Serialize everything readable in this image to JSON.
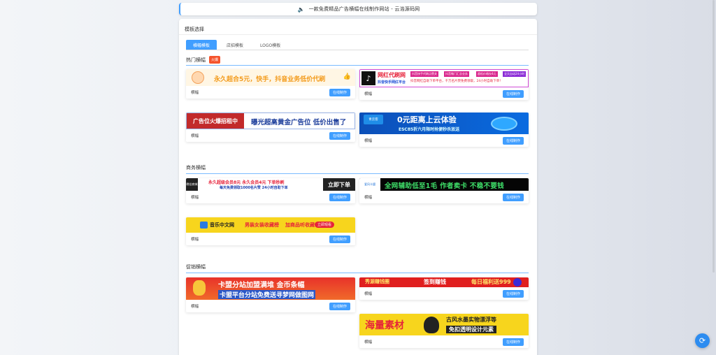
{
  "notice": {
    "text": "一款免费精品广告横幅在线制作网站 - 云浩源码网",
    "icon": "speaker-icon"
  },
  "panel": {
    "title": "模板选择"
  },
  "tabs": [
    {
      "label": "横幅模板",
      "active": true
    },
    {
      "label": "店招模板",
      "active": false
    },
    {
      "label": "LOGO模板",
      "active": false
    }
  ],
  "sections": {
    "hot": {
      "title": "热门横幅",
      "badge": "火爆"
    },
    "business": {
      "title": "商务横幅"
    },
    "promo": {
      "title": "促销横幅"
    }
  },
  "card_label": "横幅",
  "card_button": "在线制作",
  "banners": {
    "b1": {
      "text": "永久超合5元，快手，抖音业务低价代刷"
    },
    "b2": {
      "title": "网红代刷网",
      "sub": "抖音快手网红平台",
      "tags": [
        "抖音快手代刷点赞关",
        "抖音微门汇总业务",
        "超低价格仅4元",
        "全天自动24小时"
      ],
      "desc": "抖音网红自助下单平台，千万名片赞免费领取，24小时自助下单！"
    },
    "b3": {
      "tag": "广告位火爆招租中",
      "text": "曝光超高黄金广告位 低价出售了"
    },
    "b4": {
      "logo": "青云客",
      "title": "0元距离上云体验",
      "sub": "ESC85折六月限时抢便秒杀放送"
    },
    "b5": {
      "logo": "晚佳商城",
      "text1": "永久超级会员8元  永久会员4元  下单秒刷",
      "text2": "每天免费领取1000名片赞  24小时自助下单",
      "cta": "立即下单"
    },
    "b6": {
      "logo": "爱风卡盟",
      "text": "全网辅助低至1毛 作者卖卡 不稳不要钱"
    },
    "b7": {
      "brand": "音乐中文网",
      "text": "男装女装收藏榜",
      "text2": "加商品听收藏",
      "cta": "立即观看"
    },
    "b8": {
      "text1": "卡盟分站加盟满堆 金币条幅",
      "text2": "卡盟平台分站免费送寻梦网做图网"
    },
    "b9": {
      "t1": "秀源赚钱圈",
      "t2": "签到赚钱",
      "t3": "每日福利送999"
    },
    "b10": {
      "title": "海量素材",
      "t1": "古风水墨实物漂浮等",
      "t2": "免扣透明设计元素"
    }
  },
  "colors": {
    "accent": "#409eff",
    "hot": "#f5542d"
  },
  "float_button": {
    "icon": "refresh-icon"
  }
}
